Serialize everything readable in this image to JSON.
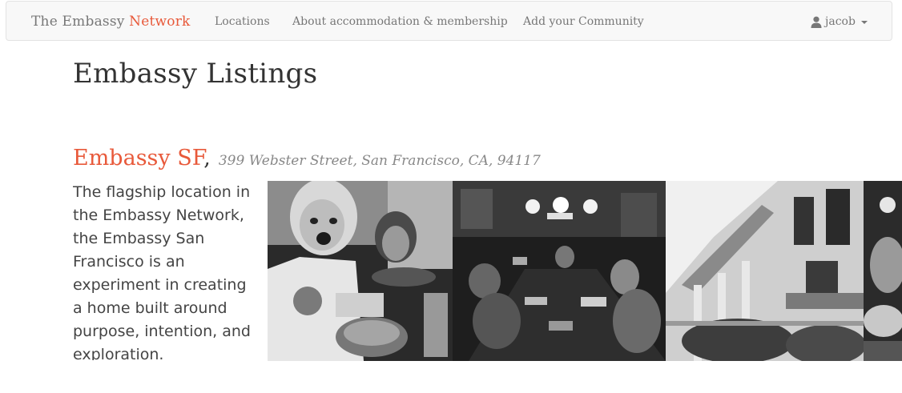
{
  "navbar": {
    "brand_main": "The Embassy",
    "brand_accent": "Network",
    "links": [
      {
        "label": "Locations"
      },
      {
        "label": "About accommodation & membership"
      },
      {
        "label": "Add your Community"
      }
    ],
    "user": {
      "icon": "user-icon",
      "name": "jacob",
      "caret_icon": "caret-down-icon"
    }
  },
  "page": {
    "title": "Embassy Listings"
  },
  "listings": [
    {
      "name": "Embassy SF",
      "separator": ",",
      "address": "399 Webster Street, San Francisco, CA, 94117",
      "description": "The flagship location in the Embassy Network, the Embassy San Francisco is an experiment in creating a home built around purpose, intention, and exploration.",
      "photos": [
        {
          "subject": "people-cooking-in-kitchen"
        },
        {
          "subject": "people-working-on-laptops-at-long-table"
        },
        {
          "subject": "victorian-house-facade"
        },
        {
          "subject": "person-at-table"
        }
      ]
    }
  ],
  "colors": {
    "accent": "#e8593a",
    "navbar_bg": "#f8f8f8",
    "text_muted": "#777777",
    "text_dark": "#333333"
  }
}
